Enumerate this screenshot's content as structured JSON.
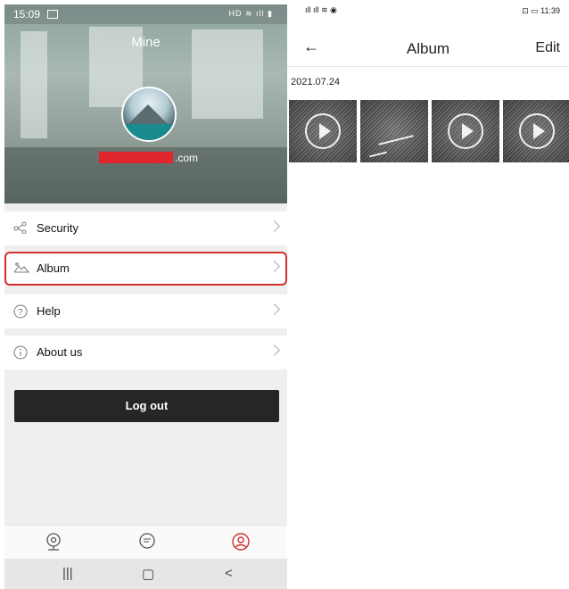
{
  "left": {
    "status": {
      "time": "15:09",
      "icons": "HD ≋ ıll ▮"
    },
    "title": "Mine",
    "email_domain": ".com",
    "menu": [
      {
        "label": "Security",
        "icon": "share-icon"
      },
      {
        "label": "Album",
        "icon": "mountain-icon"
      },
      {
        "label": "Help",
        "icon": "question-icon"
      },
      {
        "label": "About us",
        "icon": "info-icon"
      }
    ],
    "logout_label": "Log out",
    "bottom_nav": {
      "camera": "◎",
      "message": "☰",
      "profile": "☺"
    },
    "sys_nav": {
      "recents": "|||",
      "home": "▢",
      "back": "<"
    },
    "highlight_color": "#d0302e"
  },
  "right": {
    "status": {
      "left": "ıll ıll ≋ ◉",
      "right": "⊡ ▭ 11:39"
    },
    "back": "←",
    "title": "Album",
    "edit_label": "Edit",
    "date": "2021.07.24",
    "thumbnails": [
      {
        "type": "video"
      },
      {
        "type": "image"
      },
      {
        "type": "video"
      },
      {
        "type": "video"
      }
    ]
  }
}
